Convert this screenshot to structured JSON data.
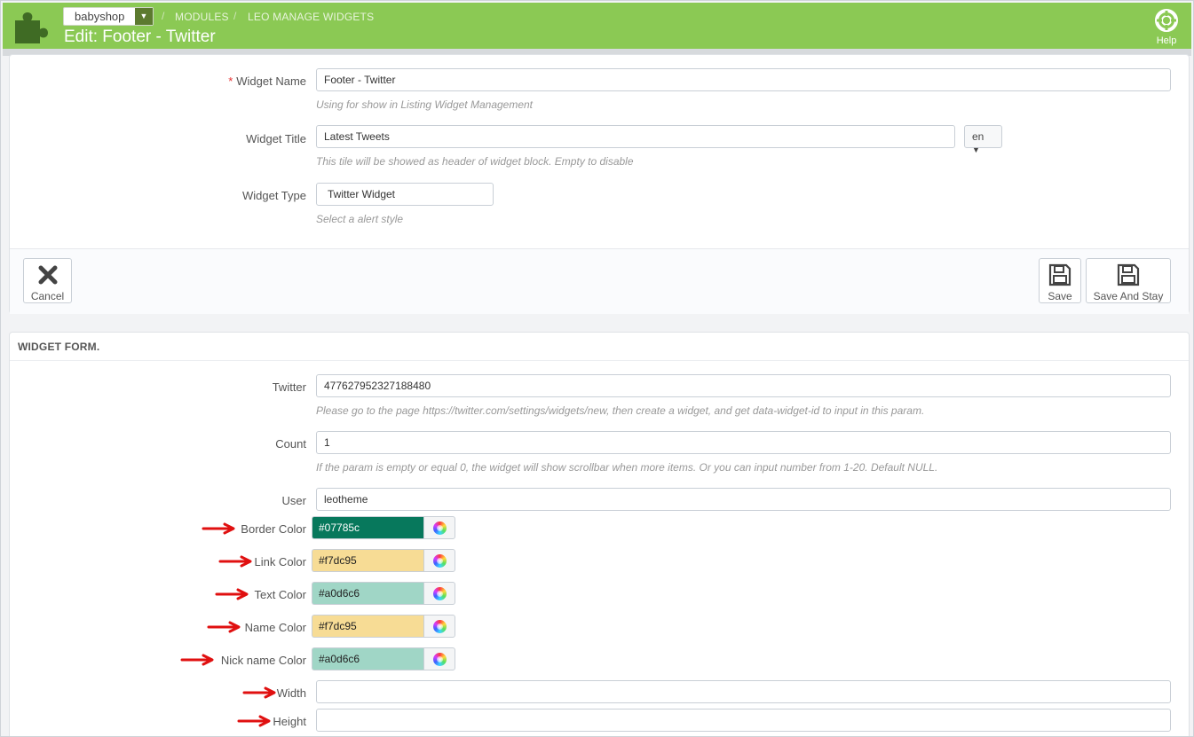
{
  "header": {
    "shop": "babyshop",
    "breadcrumb": [
      "MODULES",
      "LEO MANAGE WIDGETS"
    ],
    "title": "Edit: Footer - Twitter",
    "help_label": "Help"
  },
  "general": {
    "widget_name_label": "Widget Name",
    "widget_name_value": "Footer - Twitter",
    "widget_name_help": "Using for show in Listing Widget Management",
    "widget_title_label": "Widget Title",
    "widget_title_value": "Latest Tweets",
    "widget_title_help": "This tile will be showed as header of widget block. Empty to disable",
    "lang": "en",
    "widget_type_label": "Widget Type",
    "widget_type_value": "Twitter Widget",
    "widget_type_help": "Select a alert style"
  },
  "toolbar": {
    "cancel_label": "Cancel",
    "save_label": "Save",
    "save_stay_label": "Save And Stay"
  },
  "form": {
    "section_title": "WIDGET FORM.",
    "twitter_label": "Twitter",
    "twitter_value": "477627952327188480",
    "twitter_help": "Please go to the page https://twitter.com/settings/widgets/new, then create a widget, and get data-widget-id to input in this param.",
    "count_label": "Count",
    "count_value": "1",
    "count_help": "If the param is empty or equal 0, the widget will show scrollbar when more items. Or you can input number from 1-20. Default NULL.",
    "user_label": "User",
    "user_value": "leotheme",
    "colors": [
      {
        "label": "Border Color",
        "value": "#07785c",
        "text_color": "#ffffff"
      },
      {
        "label": "Link Color",
        "value": "#f7dc95",
        "text_color": "#222222"
      },
      {
        "label": "Text Color",
        "value": "#a0d6c6",
        "text_color": "#222222"
      },
      {
        "label": "Name Color",
        "value": "#f7dc95",
        "text_color": "#222222"
      },
      {
        "label": "Nick name Color",
        "value": "#a0d6c6",
        "text_color": "#222222"
      }
    ],
    "width_label": "Width",
    "width_value": "",
    "height_label": "Height",
    "height_value": ""
  },
  "theme": {
    "accent": "#8bc954",
    "arrow": "#e01010"
  }
}
